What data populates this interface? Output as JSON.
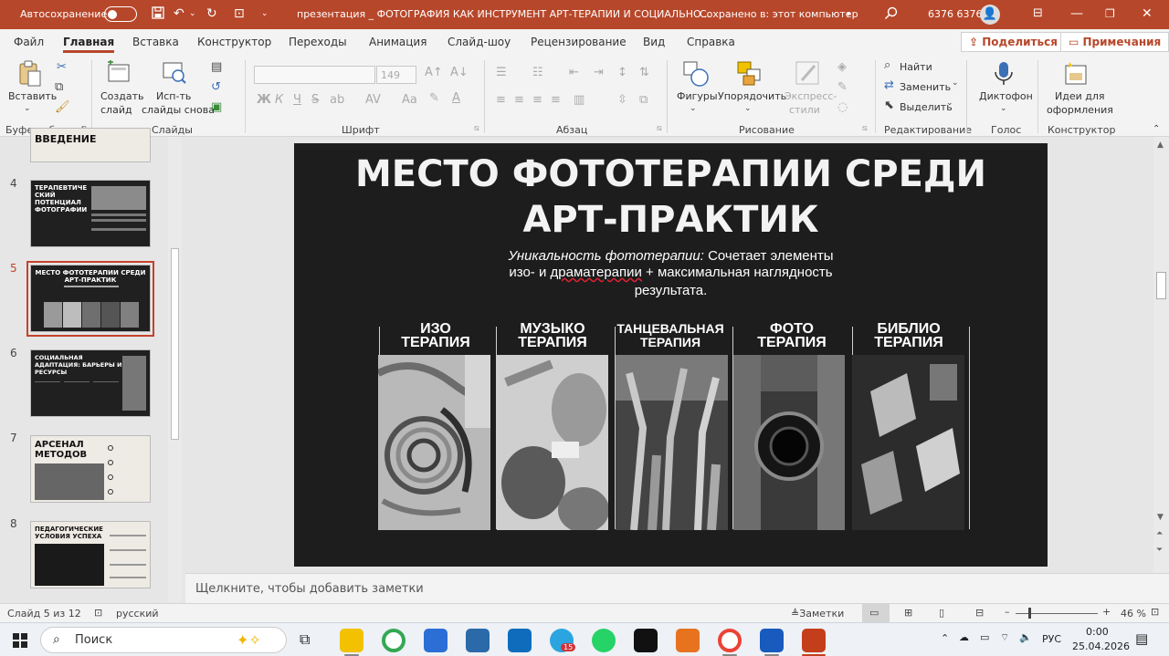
{
  "titlebar": {
    "autosave_label": "Автосохранение",
    "document_title": "презентация _ ФОТОГРАФИЯ КАК ИНСТРУМЕНТ АРТ-ТЕРАПИИ И СОЦИАЛЬНО...",
    "save_status": "Сохранено в: этот компьютер",
    "user_name": "6376 6376",
    "accent_color": "#b7472a"
  },
  "menu": {
    "tabs": [
      "Файл",
      "Главная",
      "Вставка",
      "Конструктор",
      "Переходы",
      "Анимация",
      "Слайд-шоу",
      "Рецензирование",
      "Вид",
      "Справка"
    ],
    "active_tab": "Главная",
    "share_label": "Поделиться",
    "comments_label": "Примечания"
  },
  "ribbon": {
    "clipboard": {
      "paste": "Вставить",
      "group": "Буфер обмена"
    },
    "slides": {
      "new_slide_1": "Создать",
      "new_slide_2": "слайд",
      "reuse_1": "Исп-ть",
      "reuse_2": "слайды снова",
      "group": "Слайды"
    },
    "font": {
      "size": "149",
      "bold": "Ж",
      "italic": "К",
      "underline": "Ч",
      "strike": "S",
      "group": "Шрифт"
    },
    "paragraph": {
      "group": "Абзац"
    },
    "drawing": {
      "shapes": "Фигуры",
      "arrange": "Упорядочить",
      "styles_1": "Экспресс-",
      "styles_2": "стили",
      "group": "Рисование"
    },
    "editing": {
      "find": "Найти",
      "replace": "Заменить",
      "select": "Выделить",
      "group": "Редактирование"
    },
    "voice": {
      "dictate": "Диктофон",
      "group": "Голос"
    },
    "designer": {
      "ideas_1": "Идеи для",
      "ideas_2": "оформления",
      "group": "Конструктор"
    }
  },
  "thumbnails": [
    {
      "num": "",
      "title": "ВВЕДЕНИЕ",
      "theme": "light"
    },
    {
      "num": "4",
      "title": "ТЕРАПЕВТИЧЕ\nСКИЙ\nПОТЕНЦИАЛ\nФОТОГРАФИИ",
      "theme": "dark"
    },
    {
      "num": "5",
      "title": "МЕСТО ФОТОТЕРАПИИ СРЕДИ\nАРТ-ПРАКТИК",
      "theme": "dark",
      "selected": true
    },
    {
      "num": "6",
      "title": "СОЦИАЛЬНАЯ\nАДАПТАЦИЯ: БАРЬЕРЫ И\nРЕСУРСЫ",
      "theme": "dark"
    },
    {
      "num": "7",
      "title": "АРСЕНАЛ\nМЕТОДОВ",
      "theme": "light"
    },
    {
      "num": "8",
      "title": "ПЕДАГОГИЧЕСКИЕ\nУСЛОВИЯ УСПЕХА",
      "theme": "light"
    }
  ],
  "slide": {
    "title_line1": "МЕСТО ФОТОТЕРАПИИ СРЕДИ",
    "title_line2": "АРТ-ПРАКТИК",
    "subtitle_italic": "Уникальность фототерапии:",
    "subtitle_rest": " Сочетает элементы",
    "subtitle_line2a": "изо- и ",
    "subtitle_line2_underlined": "драматерапии",
    "subtitle_line2b": " + максимальная наглядность",
    "subtitle_line3": "результата.",
    "columns": [
      {
        "line1": "ИЗО",
        "line2": "ТЕРАПИЯ"
      },
      {
        "line1": "МУЗЫКО",
        "line2": "ТЕРАПИЯ"
      },
      {
        "line1": "ТАНЦЕВАЛЬНАЯ",
        "line2": "ТЕРАПИЯ"
      },
      {
        "line1": "ФОТО",
        "line2": "ТЕРАПИЯ"
      },
      {
        "line1": "БИБЛИО",
        "line2": "ТЕРАПИЯ"
      }
    ]
  },
  "notes": {
    "placeholder": "Щелкните, чтобы добавить заметки"
  },
  "status": {
    "slide_info": "Слайд 5 из 12",
    "language": "русский",
    "notes_btn": "Заметки",
    "zoom": "46 %"
  },
  "taskbar": {
    "search": "Поиск",
    "telegram_badge": "15",
    "lang": "РУС",
    "time": "0:00",
    "date": "25.04.2026"
  }
}
